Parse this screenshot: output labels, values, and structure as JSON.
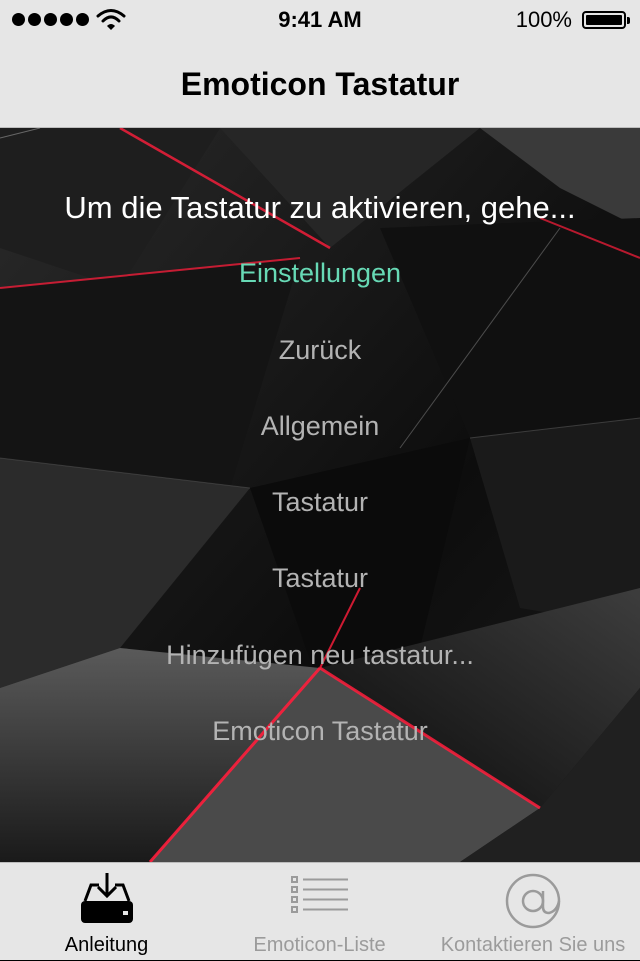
{
  "status_bar": {
    "time": "9:41 AM",
    "battery": "100%",
    "signal_icon": "signal-dots-icon",
    "wifi_icon": "wifi-icon",
    "battery_icon": "battery-icon"
  },
  "nav": {
    "title": "Emoticon Tastatur"
  },
  "instructions": {
    "heading": "Um die Tastatur zu aktivieren, gehe...",
    "steps": [
      "Einstellungen",
      "Zurück",
      "Allgemein",
      "Tastatur",
      "Tastatur",
      "Hinzufügen neu tastatur...",
      "Emoticon Tastatur"
    ]
  },
  "tabs": [
    {
      "label": "Anleitung",
      "icon": "download-tray-icon",
      "active": true
    },
    {
      "label": "Emoticon-Liste",
      "icon": "list-icon",
      "active": false
    },
    {
      "label": "Kontaktieren Sie uns",
      "icon": "at-sign-icon",
      "active": false
    }
  ],
  "colors": {
    "bar_background": "#e6e6e6",
    "highlight_step": "#67d9b5",
    "step_text": "#b3b3b3",
    "accent_red": "#ff1e3c"
  }
}
